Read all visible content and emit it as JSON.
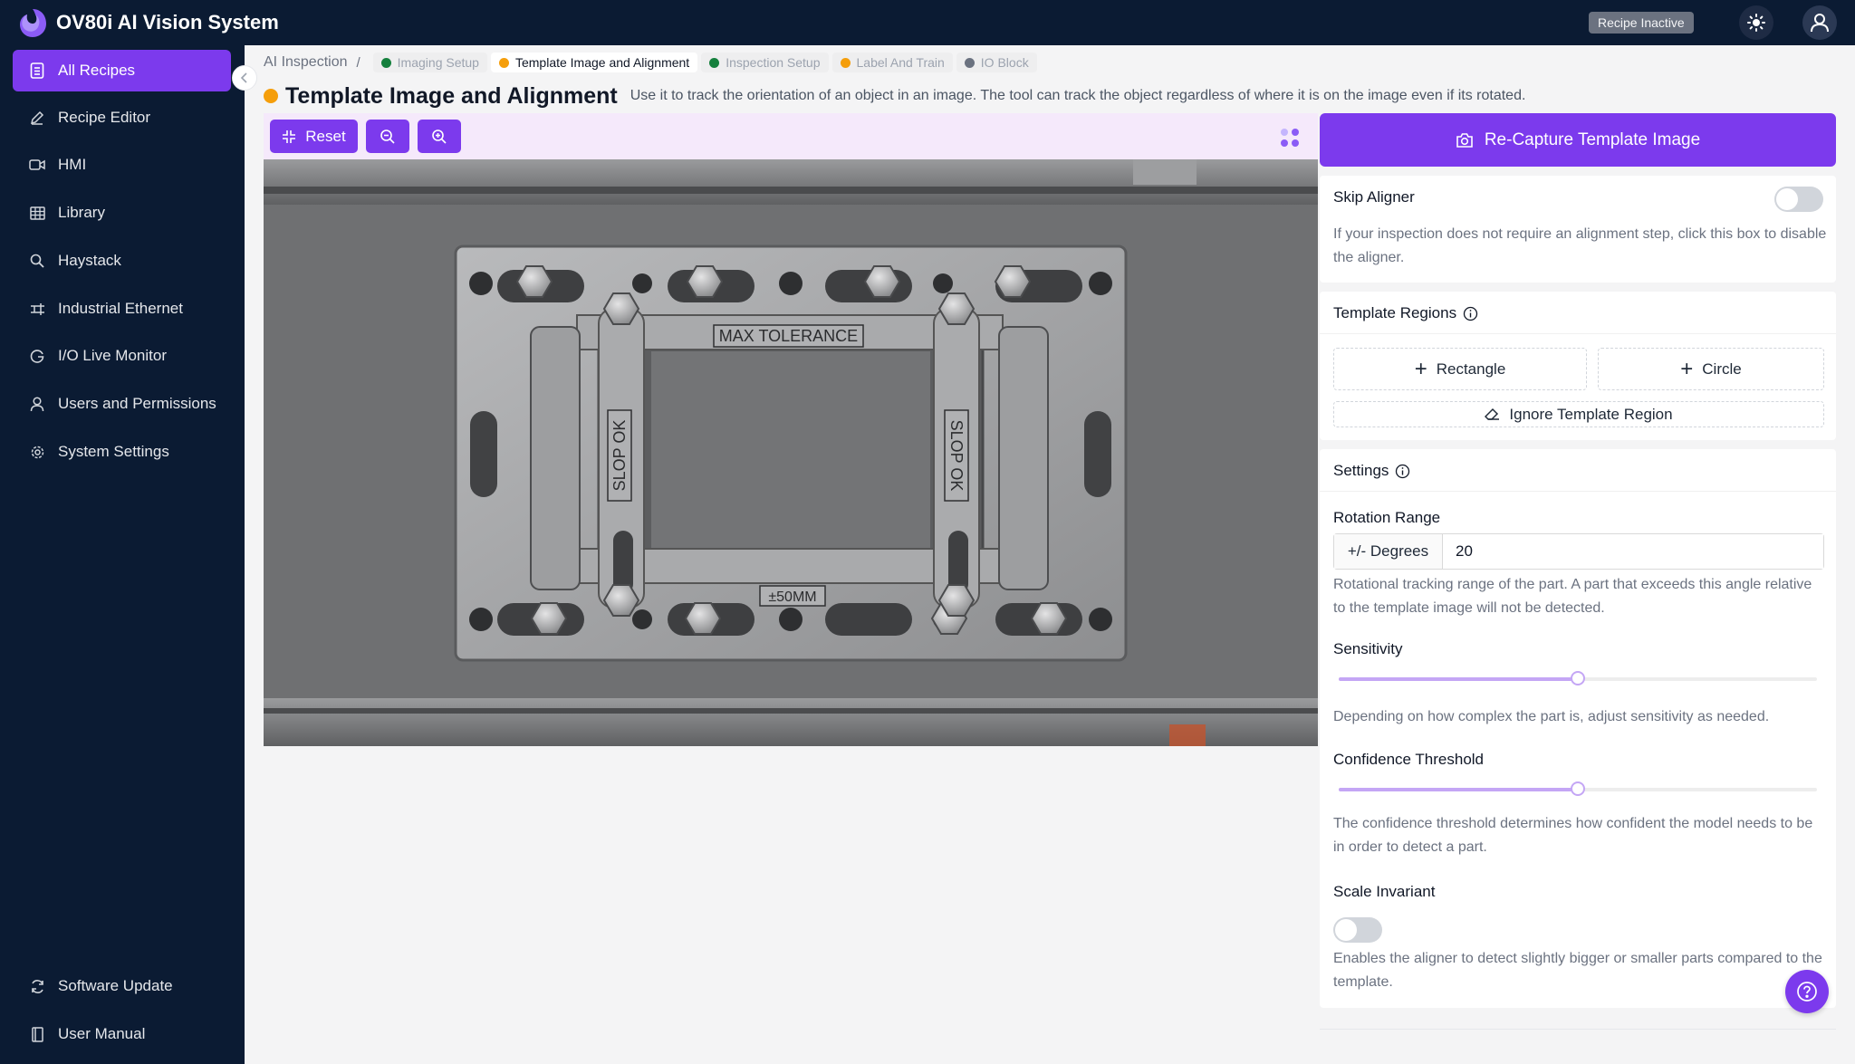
{
  "app": {
    "title": "OV80i AI Vision System",
    "status_badge": "Recipe Inactive"
  },
  "sidebar": {
    "items": [
      {
        "label": "All Recipes",
        "icon": "document-list-icon",
        "active": true
      },
      {
        "label": "Recipe Editor",
        "icon": "pencil-icon"
      },
      {
        "label": "HMI",
        "icon": "video-icon"
      },
      {
        "label": "Library",
        "icon": "grid-table-icon"
      },
      {
        "label": "Haystack",
        "icon": "search-icon"
      },
      {
        "label": "Industrial Ethernet",
        "icon": "network-icon"
      },
      {
        "label": "I/O Live Monitor",
        "icon": "monitor-g-icon"
      },
      {
        "label": "Users and Permissions",
        "icon": "user-icon"
      },
      {
        "label": "System Settings",
        "icon": "gear-icon"
      }
    ],
    "bottom_items": [
      {
        "label": "Software Update",
        "icon": "refresh-icon"
      },
      {
        "label": "User Manual",
        "icon": "book-icon"
      }
    ]
  },
  "breadcrumb": {
    "root": "AI Inspection",
    "separator": "/",
    "steps": [
      {
        "label": "Imaging Setup",
        "status_color": "#15803d"
      },
      {
        "label": "Template Image and Alignment",
        "status_color": "#f59e0b",
        "current": true
      },
      {
        "label": "Inspection Setup",
        "status_color": "#15803d"
      },
      {
        "label": "Label And Train",
        "status_color": "#f59e0b"
      },
      {
        "label": "IO Block",
        "status_color": "#6b7280"
      }
    ]
  },
  "page": {
    "title": "Template Image and Alignment",
    "status_color": "#f59e0b",
    "description": "Use it to track the orientation of an object in an image. The tool can track the object regardless of where it is on the image even if its rotated."
  },
  "toolbar": {
    "reset_label": "Reset"
  },
  "image": {
    "label_top": "MAX TOLERANCE",
    "label_left": "SLOP OK",
    "label_right": "SLOP OK",
    "label_bottom": "±50MM"
  },
  "panel": {
    "recapture_label": "Re-Capture Template Image",
    "skip_aligner": {
      "label": "Skip Aligner",
      "enabled": false,
      "help": "If your inspection does not require an alignment step, click this box to disable the aligner."
    },
    "template_regions": {
      "title": "Template Regions",
      "rectangle_label": "Rectangle",
      "circle_label": "Circle",
      "ignore_label": "Ignore Template Region"
    },
    "settings": {
      "title": "Settings",
      "rotation": {
        "label": "Rotation Range",
        "addon": "+/- Degrees",
        "value": "20",
        "help": "Rotational tracking range of the part. A part that exceeds this angle relative to the template image will not be detected."
      },
      "sensitivity": {
        "label": "Sensitivity",
        "value_fraction": 0.5,
        "help": "Depending on how complex the part is, adjust sensitivity as needed."
      },
      "confidence": {
        "label": "Confidence Threshold",
        "value_fraction": 0.5,
        "help": "The confidence threshold determines how confident the model needs to be in order to detect a part."
      },
      "scale_invariant": {
        "label": "Scale Invariant",
        "enabled": false,
        "help": "Enables the aligner to detect slightly bigger or smaller parts compared to the template."
      }
    }
  },
  "colors": {
    "accent": "#7c3aed",
    "sidebar_bg": "#0b1b33"
  }
}
